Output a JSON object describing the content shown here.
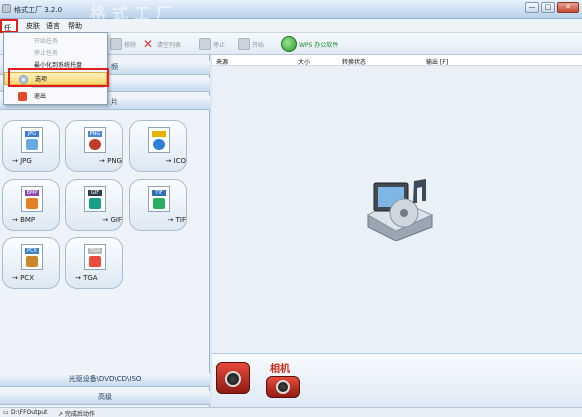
{
  "window": {
    "title": "格式工厂 3.2.0",
    "title_deco": "格式工厂",
    "buttons": {
      "minimize": "—",
      "maximize": "□",
      "close": "✕"
    }
  },
  "menubar": {
    "items": [
      "任务",
      "皮肤",
      "语言",
      "帮助"
    ]
  },
  "toolbar": {
    "items": [
      {
        "label": "移除",
        "icon": "remove-icon"
      },
      {
        "label": "清空列表",
        "icon": "clear-list-icon"
      },
      {
        "label": "停止",
        "icon": "stop-icon"
      },
      {
        "label": "开始",
        "icon": "start-icon"
      },
      {
        "label": "WPS 办公软件",
        "icon": "wps-icon"
      }
    ]
  },
  "dropdown": {
    "items": [
      {
        "label": "开始任务",
        "enabled": false
      },
      {
        "label": "停止任务",
        "enabled": false
      },
      {
        "label": "最小化到系统托盘",
        "enabled": true
      },
      {
        "label": "选项",
        "enabled": true,
        "highlighted": true
      },
      {
        "label": "退出",
        "enabled": true
      }
    ]
  },
  "left_panel": {
    "partial_labels": [
      "频",
      "片"
    ],
    "formats": [
      {
        "name": "→ JPG",
        "tag": "JPG",
        "tag_color": "#3a7bd5",
        "pic_color": "#6aa9e8"
      },
      {
        "name": "→ PNG",
        "tag": "PNG",
        "tag_color": "#4a88d1",
        "pic_color": "#c0392b"
      },
      {
        "name": "→ ICO",
        "tag": "",
        "tag_color": "#e6b400",
        "pic_color": "#2f7ed8"
      },
      {
        "name": "→ BMP",
        "tag": "BMP",
        "tag_color": "#8e44ad",
        "pic_color": "#e67e22"
      },
      {
        "name": "→ GIF",
        "tag": "GIF",
        "tag_color": "#2c3e50",
        "pic_color": "#16a085"
      },
      {
        "name": "→ TIF",
        "tag": "TIF",
        "tag_color": "#2c6fb5",
        "pic_color": "#27ae60"
      },
      {
        "name": "→ PCX",
        "tag": "PCX",
        "tag_color": "#3b82c4",
        "pic_color": "#c78a2a"
      },
      {
        "name": "→ TGA",
        "tag": "TGA",
        "tag_color": "#b8b8b8",
        "pic_color": "#e74c3c"
      }
    ],
    "bottom_categories": [
      "光驱设备\\DVD\\CD\\ISO",
      "高级"
    ]
  },
  "task_table": {
    "headers": [
      "来源",
      "大小",
      "转换状态",
      "输出 [F]"
    ]
  },
  "promo": {
    "text": "相机"
  },
  "statusbar": {
    "output_path": "D:\\FFOutput",
    "complete_action": "↗ 完成后动作"
  }
}
